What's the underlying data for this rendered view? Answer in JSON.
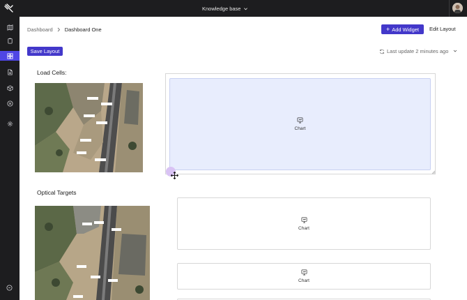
{
  "topbar": {
    "workspace_switcher": "Knowledge base"
  },
  "sidebar": {
    "items": [
      {
        "name": "map",
        "icon": "map-icon",
        "active": false
      },
      {
        "name": "clipboard",
        "icon": "clipboard-icon",
        "active": false
      },
      {
        "name": "dashboards",
        "icon": "dashboard-icon",
        "active": true
      },
      {
        "name": "documents",
        "icon": "document-icon",
        "active": false
      },
      {
        "name": "models",
        "icon": "cube-icon",
        "active": false
      },
      {
        "name": "alerts",
        "icon": "x-circle-icon",
        "active": false
      },
      {
        "name": "settings",
        "icon": "gear-icon",
        "active": false
      }
    ],
    "help_icon": "help-circle-icon"
  },
  "header": {
    "breadcrumb_parent": "Dashboard",
    "breadcrumb_current": "Dashboard One",
    "add_widget_label": "Add Widget",
    "edit_layout_label": "Edit Layout",
    "save_layout_label": "Save Layout",
    "last_update": "Last update 2 minutes ago"
  },
  "sections": {
    "load_cells_title": "Load Cells:",
    "optical_targets_title": "Optical Targets"
  },
  "widgets": [
    {
      "label": "Chart",
      "selected": true
    },
    {
      "label": "Chart",
      "selected": false
    },
    {
      "label": "Chart",
      "selected": false
    }
  ],
  "colors": {
    "primary": "#4338ca",
    "sidebar_bg": "#1d1d1f",
    "active_nav": "#4f46e5",
    "selected_widget_bg": "#e8edfd",
    "drag_dot": "#d9c3f4"
  }
}
